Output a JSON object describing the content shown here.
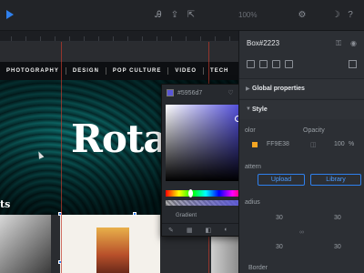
{
  "toolbar": {
    "zoom": "100%",
    "icons": [
      "play-icon",
      "text-tool-icon",
      "upload-icon",
      "export-icon",
      "settings-icon",
      "moon-icon",
      "help-icon"
    ]
  },
  "canvas": {
    "nav": [
      "PHOTOGRAPHY",
      "DESIGN",
      "POP CULTURE",
      "VIDEO",
      "TECH"
    ],
    "hero_title": "Rota",
    "section_label": "ts"
  },
  "picker": {
    "hex": "#5956d7",
    "gradient_label": "Gradient",
    "colors": {
      "selected": "#5956d7"
    }
  },
  "panel": {
    "title": "Box#2223",
    "global_properties": "Global properties",
    "style": "Style",
    "color_label": "olor",
    "color_value": "FF9E38",
    "opacity_label": "Opacity",
    "opacity_value": "100",
    "opacity_unit": "%",
    "pattern_label": "attern",
    "upload_button": "Upload",
    "library_button": "Library",
    "radius_label": "adius",
    "radius_tl": "30",
    "radius_tr": "30",
    "radius_bl": "30",
    "radius_br": "30",
    "border_label": "Border",
    "accent": "#2f80ed",
    "fill_color": "#f5a623"
  }
}
